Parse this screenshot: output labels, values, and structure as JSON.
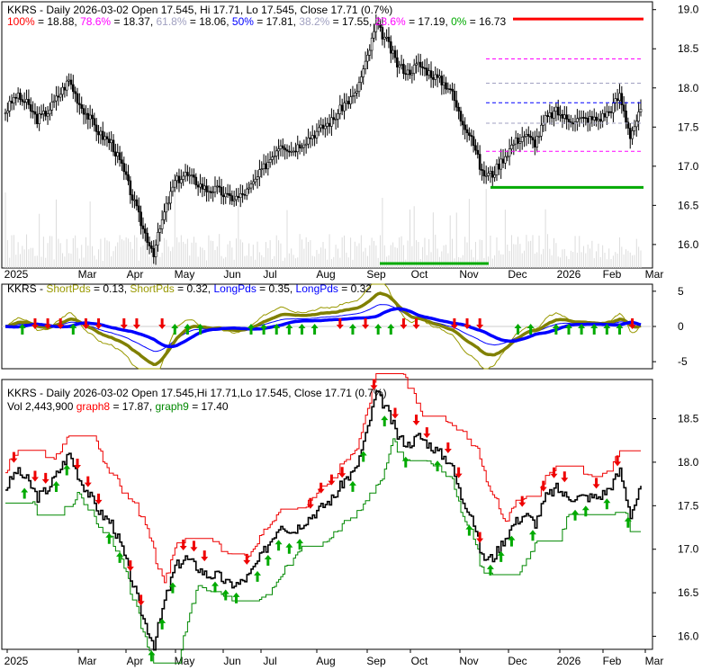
{
  "chart_data": {
    "type": "line",
    "ticker": "KKRS",
    "panels": [
      {
        "name": "price",
        "title": "KKRS - Daily 2026-03-02 Open 17.545, Hi 17.71, Lo 17.545, Close 17.71 (0.7%)",
        "fib_legend": [
          {
            "label": "100%",
            "value": "18.88",
            "color": "#ff0000"
          },
          {
            "label": "78.6%",
            "value": "18.37",
            "color": "#ff00ff"
          },
          {
            "label": "61.8%",
            "value": "18.06",
            "color": "#a0a0c0"
          },
          {
            "label": "50%",
            "value": "17.81",
            "color": "#0000ff"
          },
          {
            "label": "38.2%",
            "value": "17.55",
            "color": "#a0a0c0"
          },
          {
            "label": "23.6%",
            "value": "17.19",
            "color": "#ff00ff"
          },
          {
            "label": "0%",
            "value": "16.73",
            "color": "#00aa00"
          }
        ],
        "yticks": [
          "19.0",
          "18.5",
          "18.0",
          "17.5",
          "17.0",
          "16.5",
          "16.0"
        ],
        "ylim": [
          15.7,
          19.1
        ]
      },
      {
        "name": "oscillator",
        "title_prefix": "KKRS - ",
        "legend": [
          {
            "label": "ShortPds",
            "value": "0.13",
            "color": "#999900"
          },
          {
            "label": "ShortPds",
            "value": "0.32",
            "color": "#999900"
          },
          {
            "label": "LongPds",
            "value": "0.35",
            "color": "#0000ff"
          },
          {
            "label": "LongPds",
            "value": "0.32",
            "color": "#0000ff"
          }
        ],
        "yticks": [
          "5",
          "0",
          "-5"
        ],
        "ylim": [
          -6,
          6
        ]
      },
      {
        "name": "stops",
        "title": "KKRS - Daily 2026-03-02 Open 17.545,Hi 17.71,Lo 17.545, Close 17.71 (0.7%)",
        "vol_text": "Vol 2,443,900",
        "legend": [
          {
            "label": "graph8",
            "value": "17.87",
            "color": "#ff0000"
          },
          {
            "label": "graph9",
            "value": "17.40",
            "color": "#008800"
          }
        ],
        "yticks": [
          "18.5",
          "18.0",
          "17.5",
          "17.0",
          "16.5",
          "16.0"
        ],
        "ylim": [
          15.85,
          18.95
        ]
      }
    ],
    "xticks": [
      "2025",
      "Mar",
      "Apr",
      "May",
      "Jun",
      "Jul",
      "Aug",
      "Sep",
      "Oct",
      "Nov",
      "Dec",
      "2026",
      "Feb",
      "Mar"
    ],
    "weekly_close": [
      17.7,
      17.9,
      17.8,
      17.6,
      17.7,
      17.9,
      18.1,
      17.8,
      17.6,
      17.4,
      17.3,
      17.0,
      16.6,
      16.2,
      15.9,
      16.4,
      16.8,
      16.9,
      16.8,
      16.7,
      16.7,
      16.6,
      16.6,
      16.7,
      16.9,
      17.1,
      17.3,
      17.2,
      17.3,
      17.4,
      17.5,
      17.6,
      17.8,
      17.9,
      18.3,
      18.8,
      18.6,
      18.3,
      18.2,
      18.3,
      18.2,
      18.1,
      18.0,
      17.6,
      17.4,
      16.9,
      16.9,
      17.1,
      17.3,
      17.4,
      17.3,
      17.6,
      17.7,
      17.6,
      17.6,
      17.6,
      17.6,
      17.7,
      17.9,
      17.4,
      17.71
    ]
  }
}
